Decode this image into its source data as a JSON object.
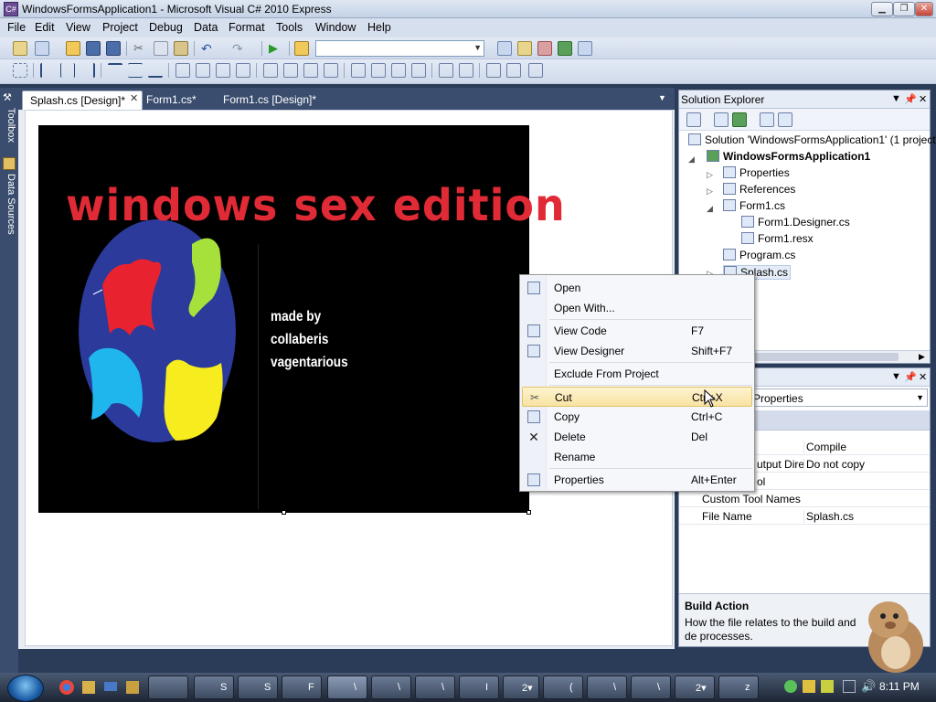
{
  "window": {
    "title": "WindowsFormsApplication1 - Microsoft Visual C# 2010 Express",
    "app_icon": "visual-studio-icon"
  },
  "menu": [
    "File",
    "Edit",
    "View",
    "Project",
    "Debug",
    "Data",
    "Format",
    "Tools",
    "Window",
    "Help"
  ],
  "left_strip": {
    "toolbox": "Toolbox",
    "data_sources": "Data Sources"
  },
  "doc_tabs": [
    {
      "label": "Splash.cs [Design]*",
      "active": true
    },
    {
      "label": "Form1.cs*",
      "active": false
    },
    {
      "label": "Form1.cs [Design]*",
      "active": false
    }
  ],
  "splash": {
    "title": "windows sex edition",
    "credits": [
      "made by",
      "collaberis",
      "vagentarious"
    ],
    "colors": {
      "background": "#000000",
      "title": "#e02a35",
      "globe": "#2b3a9b"
    }
  },
  "solution_explorer": {
    "title": "Solution Explorer",
    "items": [
      {
        "label": "Solution 'WindowsFormsApplication1' (1 project)",
        "icon": "solution-icon"
      },
      {
        "label": "WindowsFormsApplication1",
        "icon": "csharp-project-icon",
        "bold": true
      },
      {
        "label": "Properties",
        "icon": "properties-folder-icon"
      },
      {
        "label": "References",
        "icon": "references-icon"
      },
      {
        "label": "Form1.cs",
        "icon": "form-icon"
      },
      {
        "label": "Form1.Designer.cs",
        "icon": "cs-file-icon"
      },
      {
        "label": "Form1.resx",
        "icon": "resx-icon"
      },
      {
        "label": "Program.cs",
        "icon": "cs-file-icon"
      },
      {
        "label": "Splash.cs",
        "icon": "form-icon"
      }
    ]
  },
  "properties": {
    "selector": "Properties",
    "rows": [
      {
        "name": "n",
        "value": "Compile"
      },
      {
        "name": "utput Dire",
        "value": "Do not copy"
      },
      {
        "name": "ol",
        "value": ""
      },
      {
        "name": "Custom Tool Names",
        "value": ""
      },
      {
        "name": "File Name",
        "value": "Splash.cs"
      }
    ],
    "desc_title": "Build Action",
    "desc_text": "How the file relates to the build and de processes."
  },
  "context_menu": [
    {
      "label": "Open",
      "key": "",
      "icon": "open-icon"
    },
    {
      "label": "Open With...",
      "key": "",
      "icon": ""
    },
    {
      "label": "View Code",
      "key": "F7",
      "icon": "view-code-icon"
    },
    {
      "label": "View Designer",
      "key": "Shift+F7",
      "icon": "view-designer-icon"
    },
    {
      "label": "Exclude From Project",
      "key": "",
      "icon": ""
    },
    {
      "label": "Cut",
      "key": "Ctrl+X",
      "icon": "scissors-icon",
      "highlighted": true
    },
    {
      "label": "Copy",
      "key": "Ctrl+C",
      "icon": "copy-icon"
    },
    {
      "label": "Delete",
      "key": "Del",
      "icon": "delete-icon"
    },
    {
      "label": "Rename",
      "key": "",
      "icon": ""
    },
    {
      "label": "Properties",
      "key": "Alt+Enter",
      "icon": "properties-icon"
    }
  ],
  "taskbar": {
    "buttons": [
      "",
      "S",
      "S",
      "F",
      "\\",
      "\\",
      "\\",
      "I",
      "2▾",
      "(",
      "\\",
      "\\",
      "2▾",
      "z"
    ],
    "clock": "8:11 PM"
  }
}
